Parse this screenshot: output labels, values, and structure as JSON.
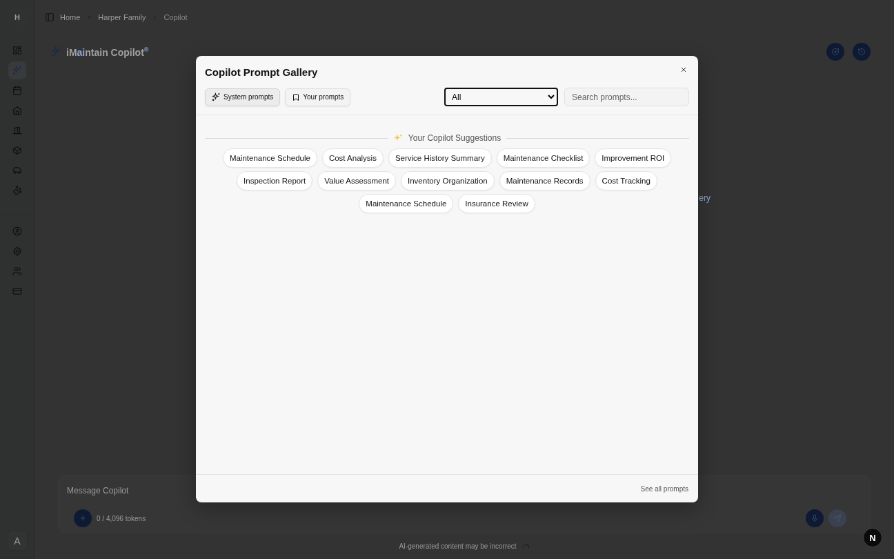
{
  "workspace": {
    "initial": "H"
  },
  "sidebar": {
    "items": [
      {
        "selected": false
      },
      {
        "selected": true
      },
      {
        "selected": false
      },
      {
        "selected": false
      },
      {
        "selected": false
      },
      {
        "selected": false
      },
      {
        "selected": false
      },
      {
        "selected": false
      }
    ],
    "account_items": [
      {
        "selected": false
      },
      {
        "selected": false
      },
      {
        "selected": false
      },
      {
        "selected": false
      }
    ],
    "avatar": "A"
  },
  "breadcrumb": [
    "Home",
    "Harper Family",
    "Copilot"
  ],
  "page_title": {
    "before": "iM",
    "highlight": "ai",
    "after": "ntain Copilot",
    "mark": "®"
  },
  "background_link": "ery",
  "composer": {
    "placeholder": "Message Copilot",
    "tokens": "0 / 4,096 tokens"
  },
  "disclaimer": "AI-generated content may be incorrect",
  "dev_badge": "N",
  "dialog": {
    "title": "Copilot Prompt Gallery",
    "tabs": [
      {
        "label": "System prompts",
        "selected": true
      },
      {
        "label": "Your prompts",
        "selected": false
      }
    ],
    "filter": {
      "value": "All"
    },
    "search": {
      "placeholder": "Search prompts..."
    },
    "section_title": "Your Copilot Suggestions",
    "prompts": [
      "Maintenance Schedule",
      "Cost Analysis",
      "Service History Summary",
      "Maintenance Checklist",
      "Improvement ROI",
      "Inspection Report",
      "Value Assessment",
      "Inventory Organization",
      "Maintenance Records",
      "Cost Tracking",
      "Maintenance Schedule",
      "Insurance Review"
    ],
    "footer_link": "See all prompts"
  }
}
